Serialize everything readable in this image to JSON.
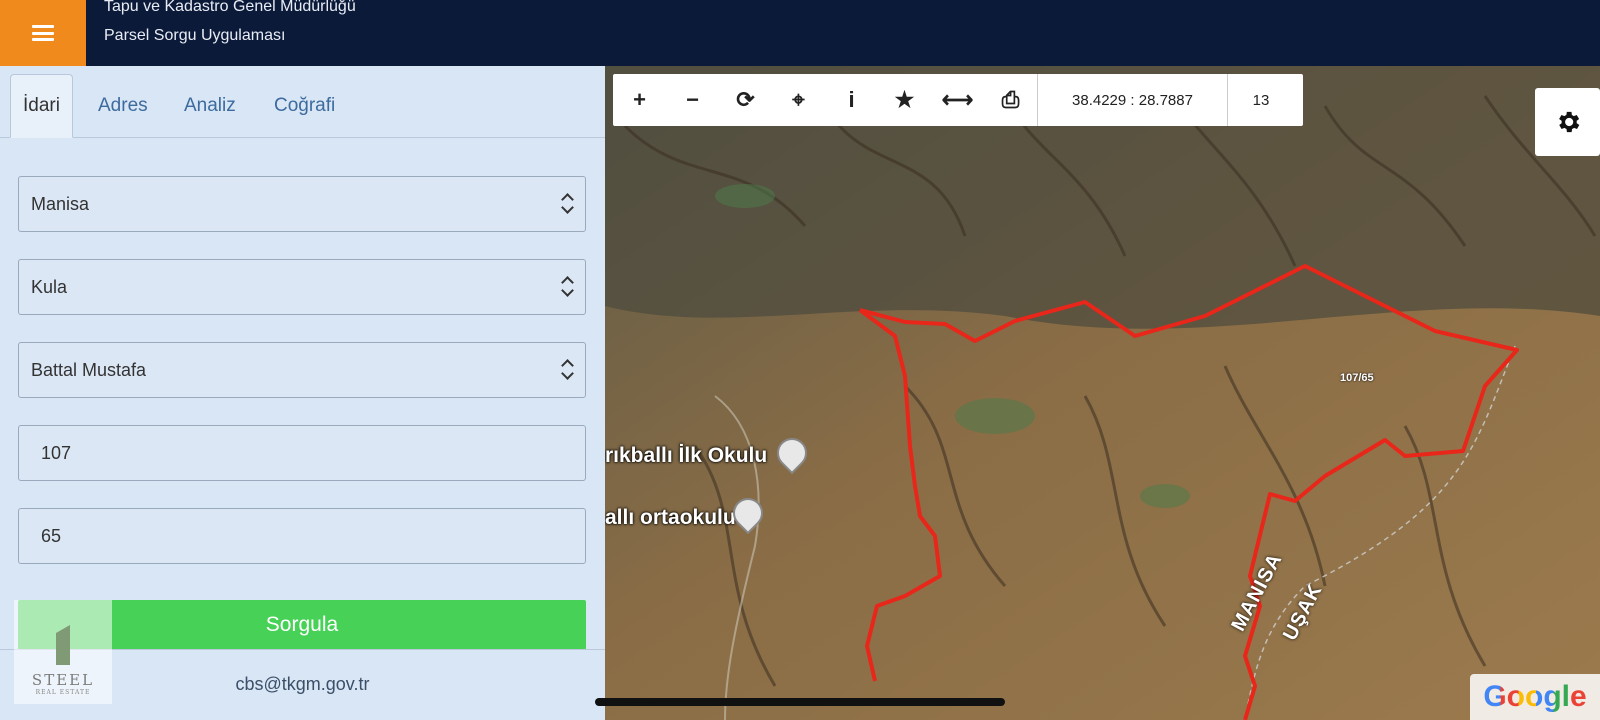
{
  "header": {
    "title_line1": "Tapu ve Kadastro Genel Müdürlüğü",
    "title_line2": "Parsel Sorgu Uygulaması"
  },
  "tabs": [
    {
      "label": "İdari",
      "active": true
    },
    {
      "label": "Adres",
      "active": false
    },
    {
      "label": "Analiz",
      "active": false
    },
    {
      "label": "Coğrafi",
      "active": false
    }
  ],
  "form": {
    "province": "Manisa",
    "district": "Kula",
    "neighborhood": "Battal Mustafa",
    "block": "107",
    "parcel": "65",
    "submit_label": "Sorgula"
  },
  "footer": {
    "email": "cbs@tkgm.gov.tr"
  },
  "watermark_logo": {
    "name": "STEEL",
    "sub": "REAL ESTATE"
  },
  "map": {
    "toolbar": {
      "tools": [
        {
          "icon": "zoom-in-icon",
          "glyph": "+"
        },
        {
          "icon": "zoom-out-icon",
          "glyph": "−"
        },
        {
          "icon": "refresh-icon",
          "glyph": "⟳"
        },
        {
          "icon": "locate-icon",
          "glyph": "⌖"
        },
        {
          "icon": "info-icon",
          "glyph": "i"
        },
        {
          "icon": "star-icon",
          "glyph": "★"
        },
        {
          "icon": "measure-icon",
          "glyph": "⟷"
        },
        {
          "icon": "print-icon",
          "glyph": "⎙"
        }
      ],
      "coordinates": "38.4229 : 28.7887",
      "zoom_level": "13"
    },
    "poi": [
      {
        "label": "rıkballı İlk Okulu",
        "icon": "school-pin-icon"
      },
      {
        "label": "allı ortaokulu",
        "icon": "school-pin-icon"
      }
    ],
    "parcel_label": "107/65",
    "regions": [
      "MANISA",
      "UŞAK"
    ],
    "attribution": "Google",
    "boundary_color": "#e8261a"
  },
  "colors": {
    "header_bg": "#0c1a3a",
    "menu_accent": "#f08a1c",
    "submit_green": "#47d157",
    "sidebar_bg": "#d8e6f5"
  }
}
